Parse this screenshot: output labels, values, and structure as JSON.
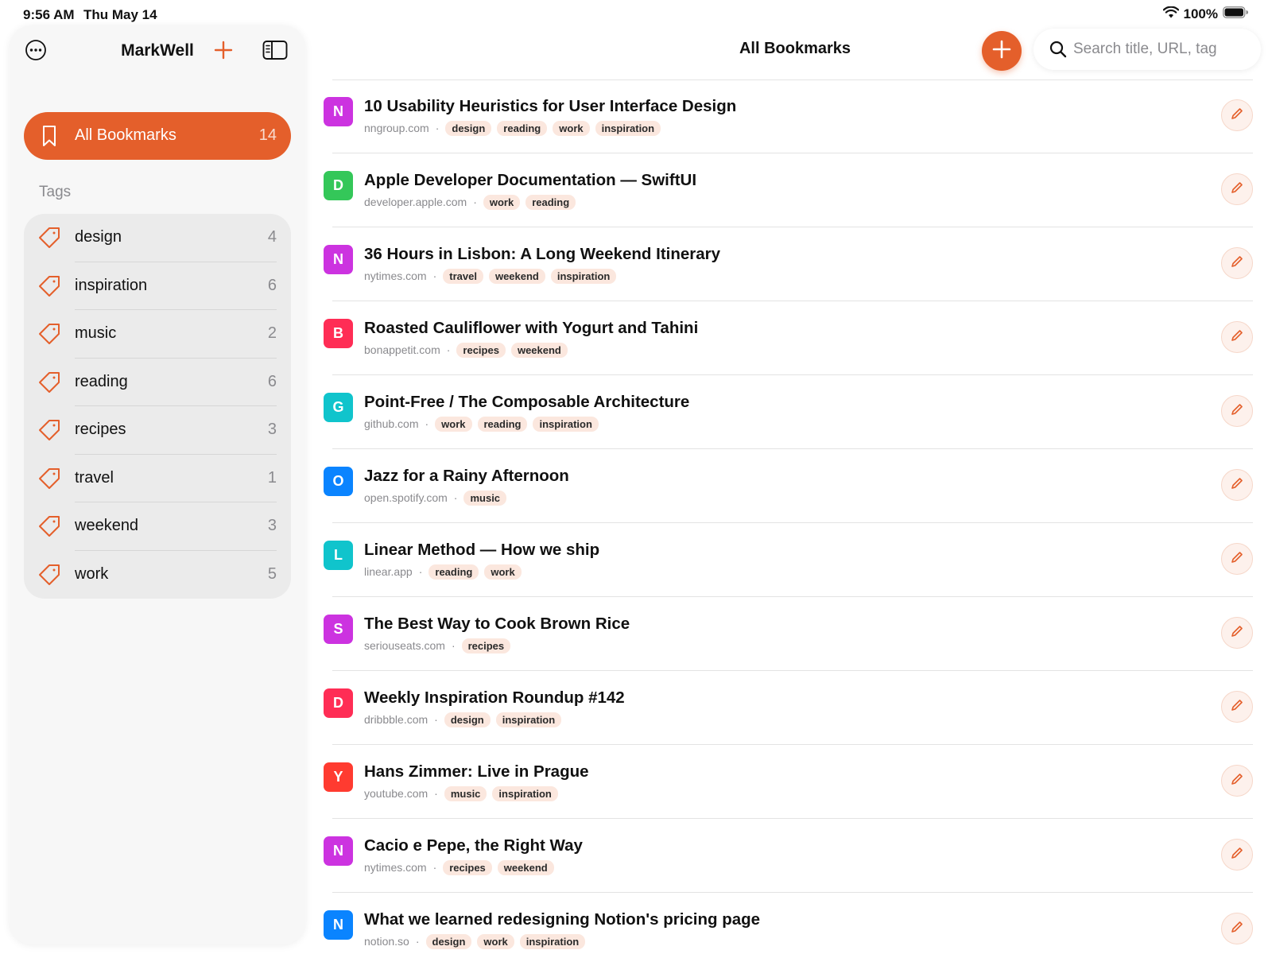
{
  "status_bar": {
    "time": "9:56 AM",
    "date": "Thu May 14",
    "battery": "100%"
  },
  "sidebar": {
    "title": "MarkWell",
    "all_bookmarks": {
      "label": "All Bookmarks",
      "count": "14"
    },
    "tags_header": "Tags",
    "tags": [
      {
        "label": "design",
        "count": "4"
      },
      {
        "label": "inspiration",
        "count": "6"
      },
      {
        "label": "music",
        "count": "2"
      },
      {
        "label": "reading",
        "count": "6"
      },
      {
        "label": "recipes",
        "count": "3"
      },
      {
        "label": "travel",
        "count": "1"
      },
      {
        "label": "weekend",
        "count": "3"
      },
      {
        "label": "work",
        "count": "5"
      }
    ]
  },
  "main": {
    "title": "All Bookmarks",
    "search": {
      "placeholder": "Search title, URL, tag",
      "value": ""
    }
  },
  "colors": {
    "accent": "#e45f2b",
    "chip_bg": "#fbe7de"
  },
  "bookmarks": [
    {
      "initial": "N",
      "color": "#cc33e0",
      "title": "10 Usability Heuristics for User Interface Design",
      "domain": "nngroup.com",
      "tags": [
        "design",
        "reading",
        "work",
        "inspiration"
      ]
    },
    {
      "initial": "D",
      "color": "#34c759",
      "title": "Apple Developer Documentation — SwiftUI",
      "domain": "developer.apple.com",
      "tags": [
        "work",
        "reading"
      ]
    },
    {
      "initial": "N",
      "color": "#cc33e0",
      "title": "36 Hours in Lisbon: A Long Weekend Itinerary",
      "domain": "nytimes.com",
      "tags": [
        "travel",
        "weekend",
        "inspiration"
      ]
    },
    {
      "initial": "B",
      "color": "#ff2d55",
      "title": "Roasted Cauliflower with Yogurt and Tahini",
      "domain": "bonappetit.com",
      "tags": [
        "recipes",
        "weekend"
      ]
    },
    {
      "initial": "G",
      "color": "#10c4cc",
      "title": "Point-Free / The Composable Architecture",
      "domain": "github.com",
      "tags": [
        "work",
        "reading",
        "inspiration"
      ]
    },
    {
      "initial": "O",
      "color": "#0a84ff",
      "title": "Jazz for a Rainy Afternoon",
      "domain": "open.spotify.com",
      "tags": [
        "music"
      ]
    },
    {
      "initial": "L",
      "color": "#10c4cc",
      "title": "Linear Method — How we ship",
      "domain": "linear.app",
      "tags": [
        "reading",
        "work"
      ]
    },
    {
      "initial": "S",
      "color": "#cc33e0",
      "title": "The Best Way to Cook Brown Rice",
      "domain": "seriouseats.com",
      "tags": [
        "recipes"
      ]
    },
    {
      "initial": "D",
      "color": "#ff2d55",
      "title": "Weekly Inspiration Roundup #142",
      "domain": "dribbble.com",
      "tags": [
        "design",
        "inspiration"
      ]
    },
    {
      "initial": "Y",
      "color": "#ff3b30",
      "title": "Hans Zimmer: Live in Prague",
      "domain": "youtube.com",
      "tags": [
        "music",
        "inspiration"
      ]
    },
    {
      "initial": "N",
      "color": "#cc33e0",
      "title": "Cacio e Pepe, the Right Way",
      "domain": "nytimes.com",
      "tags": [
        "recipes",
        "weekend"
      ]
    },
    {
      "initial": "N",
      "color": "#0a84ff",
      "title": "What we learned redesigning Notion's pricing page",
      "domain": "notion.so",
      "tags": [
        "design",
        "work",
        "inspiration"
      ]
    }
  ]
}
